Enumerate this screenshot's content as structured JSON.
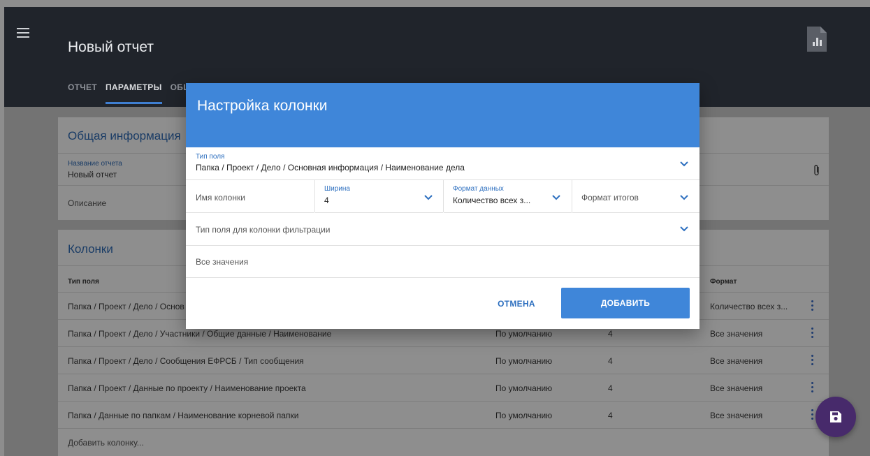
{
  "app": {
    "title": "Новый отчет",
    "tabs": [
      {
        "label": "ОТЧЕТ"
      },
      {
        "label": "ПАРАМЕТРЫ"
      },
      {
        "label": "ОБЩ"
      }
    ]
  },
  "general": {
    "title": "Общая информация",
    "name_label": "Название отчета",
    "name_value": "Новый отчет",
    "description": "Описание"
  },
  "columns": {
    "title": "Колонки",
    "headers": {
      "field_type": "Тип поля",
      "format": "Формат"
    },
    "rows": [
      {
        "path": "Папка / Проект / Дело / Основ",
        "total": "",
        "width": "",
        "format": "Количество всех з..."
      },
      {
        "path": "Папка / Проект / Дело / Участники / Общие данные / Наименование",
        "total": "По умолчанию",
        "width": "4",
        "format": "Все значения"
      },
      {
        "path": "Папка / Проект / Дело / Сообщения ЕФРСБ / Тип сообщения",
        "total": "По умолчанию",
        "width": "4",
        "format": "Все значения"
      },
      {
        "path": "Папка / Проект / Данные по проекту / Наименование проекта",
        "total": "По умолчанию",
        "width": "4",
        "format": "Все значения"
      },
      {
        "path": "Папка / Данные по папкам / Наименование корневой папки",
        "total": "По умолчанию",
        "width": "4",
        "format": "Все значения"
      }
    ],
    "add_column": "Добавить колонку..."
  },
  "dialog": {
    "title": "Настройка колонки",
    "field_type_label": "Тип поля",
    "field_type_value": "Папка / Проект / Дело / Основная информация / Наименование дела",
    "column_name_placeholder": "Имя колонки",
    "width_label": "Ширина",
    "width_value": "4",
    "data_format_label": "Формат данных",
    "data_format_value": "Количество всех з...",
    "totals_format_placeholder": "Формат итогов",
    "filter_field_placeholder": "Тип поля для колонки фильтрации",
    "values_placeholder": "Все значения",
    "cancel": "ОТМЕНА",
    "add": "ДОБАВИТЬ"
  },
  "colors": {
    "accent": "#3f86d9",
    "header_dark": "#20242b",
    "fab": "#472a6b"
  },
  "icons": [
    "menu-icon",
    "report-file-icon",
    "paperclip-icon",
    "chevron-down-icon",
    "more-vert-icon",
    "save-icon"
  ]
}
